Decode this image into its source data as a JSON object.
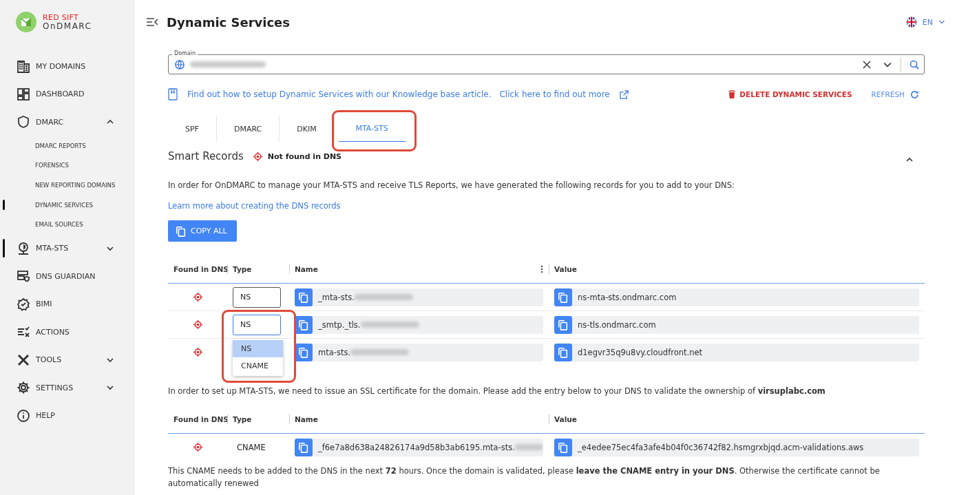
{
  "brand": {
    "line1": "RED SIFT",
    "line2": "OnDMARC"
  },
  "sidebar": {
    "items": [
      {
        "label": "MY DOMAINS",
        "selected": false
      },
      {
        "label": "DASHBOARD",
        "selected": false
      },
      {
        "label": "DMARC",
        "selected": false,
        "expanded": true,
        "children": [
          {
            "label": "DMARC REPORTS",
            "selected": false
          },
          {
            "label": "FORENSICS",
            "selected": false
          },
          {
            "label": "NEW REPORTING DOMAINS",
            "selected": false
          },
          {
            "label": "DYNAMIC SERVICES",
            "selected": true
          },
          {
            "label": "EMAIL SOURCES",
            "selected": false
          }
        ]
      },
      {
        "label": "MTA-STS",
        "selected": true,
        "expanded": false
      },
      {
        "label": "DNS GUARDIAN",
        "selected": false
      },
      {
        "label": "BIMI",
        "selected": false
      },
      {
        "label": "ACTIONS",
        "selected": false
      },
      {
        "label": "TOOLS",
        "selected": false,
        "expanded": false
      },
      {
        "label": "SETTINGS",
        "selected": false,
        "expanded": false
      },
      {
        "label": "HELP",
        "selected": false
      }
    ]
  },
  "header": {
    "title": "Dynamic Services",
    "language": "EN"
  },
  "domain_field": {
    "label": "Domain"
  },
  "info": {
    "text": "Find out how to setup Dynamic Services with our Knowledge base article.",
    "link": "Click here to find out more",
    "delete": "DELETE DYNAMIC SERVICES",
    "refresh": "REFRESH"
  },
  "tabs": [
    {
      "label": "SPF",
      "selected": false,
      "highlighted": false
    },
    {
      "label": "DMARC",
      "selected": false,
      "highlighted": false
    },
    {
      "label": "DKIM",
      "selected": false,
      "highlighted": false
    },
    {
      "label": "MTA-STS",
      "selected": true,
      "highlighted": true
    }
  ],
  "smart_records": {
    "title": "Smart Records",
    "status": "Not found in DNS",
    "found": false,
    "expanded": true,
    "intro": "In order for OnDMARC to manage your MTA-STS and receive TLS Reports, we have generated the following records for you to add to your DNS:",
    "learn_link": "Learn more about creating the DNS records",
    "copy_all": "COPY ALL",
    "columns": [
      "Found in DNS",
      "Type",
      "Name",
      "Value"
    ],
    "rows": [
      {
        "found": false,
        "type": "NS",
        "type_open": false,
        "name": "_mta-sts.",
        "name_blurred": true,
        "value": "ns-mta-sts.ondmarc.com"
      },
      {
        "found": false,
        "type": "NS",
        "type_open": true,
        "name": "_smtp._tls.",
        "name_blurred": true,
        "value": "ns-tls.ondmarc.com"
      },
      {
        "found": false,
        "name": "mta-sts.",
        "name_blurred": true,
        "value": "d1egvr35q9u8vy.cloudfront.net"
      }
    ],
    "type_menu": {
      "highlighted": true,
      "options": [
        {
          "label": "NS",
          "selected": true
        },
        {
          "label": "CNAME",
          "selected": false
        }
      ]
    }
  },
  "certificate": {
    "intro": "In order to set up MTA-STS, we need to issue an SSL certificate for the domain. Please add the entry below to your DNS to validate the ownership of **virsuplabc.com**",
    "columns": [
      "Found in DNS",
      "Type",
      "Name",
      "Value"
    ],
    "rows": [
      {
        "found": false,
        "type": "CNAME",
        "name": "_f6e7a8d638a24826174a9d58b3ab6195.mta-sts.",
        "name_blurred": true,
        "value": "_e4edee75ec4fa3afe4b04f0c36742f82.hsmgrxbjqd.acm-validations.aws"
      }
    ],
    "note": "This CNAME needs to be added to the DNS in the next **72** hours. Once the domain is validated, please **leave the CNAME entry in your DNS**. Otherwise the certificate cannot be automatically renewed"
  }
}
